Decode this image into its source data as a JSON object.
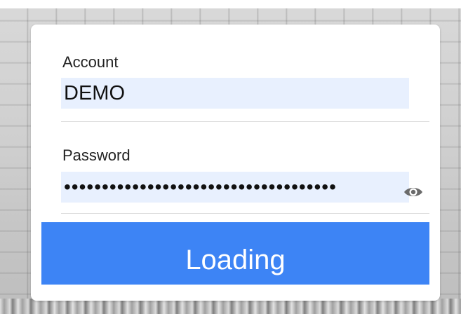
{
  "login": {
    "account": {
      "label": "Account",
      "value": "DEMO"
    },
    "password": {
      "label": "Password",
      "value": "••••••••••••••••••••••••••••••••••••",
      "toggle_icon": "eye-icon"
    },
    "submit": {
      "label": "Loading"
    }
  },
  "colors": {
    "primary": "#3d84f5",
    "input_background": "#e8f0fe",
    "card_background": "#ffffff"
  }
}
